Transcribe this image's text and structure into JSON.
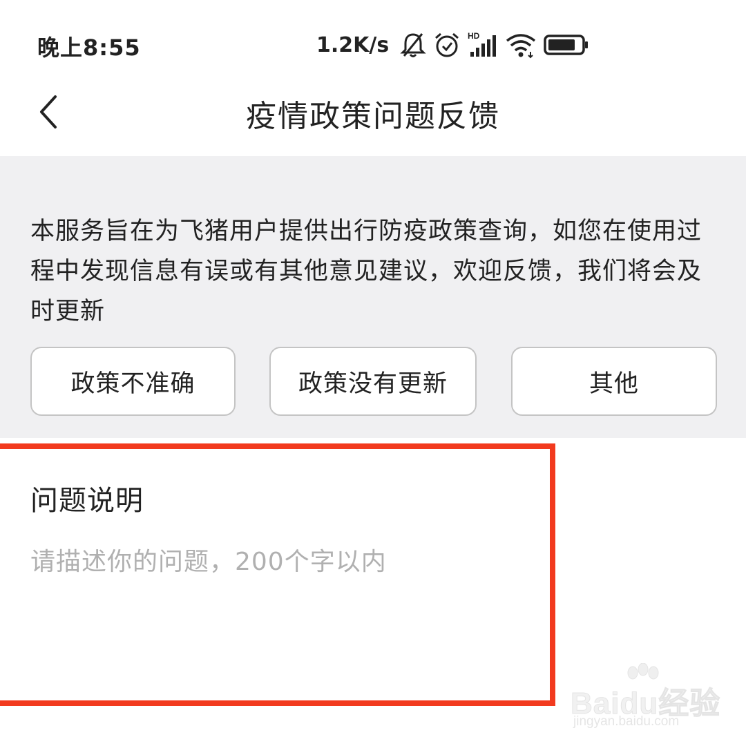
{
  "status_bar": {
    "time": "晚上8:55",
    "net_speed": "1.2K/s",
    "icons": [
      "bell-muted-icon",
      "alarm-icon",
      "hd-signal-icon",
      "wifi-icon",
      "battery-icon"
    ],
    "signal_badge": "HD"
  },
  "nav": {
    "back_icon": "chevron-left-icon",
    "title": "疫情政策问题反馈"
  },
  "info": {
    "description": "本服务旨在为飞猪用户提供出行防疫政策查询，如您在使用过程中发现信息有误或有其他意见建议，欢迎反馈，我们将会及时更新",
    "options": [
      {
        "label": "政策不准确"
      },
      {
        "label": "政策没有更新"
      },
      {
        "label": "其他"
      }
    ]
  },
  "problem": {
    "label": "问题说明",
    "placeholder": "请描述你的问题，200个字以内"
  },
  "annotation": {
    "highlight_color": "#f23a1e"
  },
  "watermark": {
    "brand": "Baidu经验",
    "url": "jingyan.baidu.com"
  },
  "colors": {
    "section_bg": "#f0f0f2",
    "button_border": "#c4c4c4",
    "placeholder": "#b0b0b0",
    "text": "#222222"
  }
}
